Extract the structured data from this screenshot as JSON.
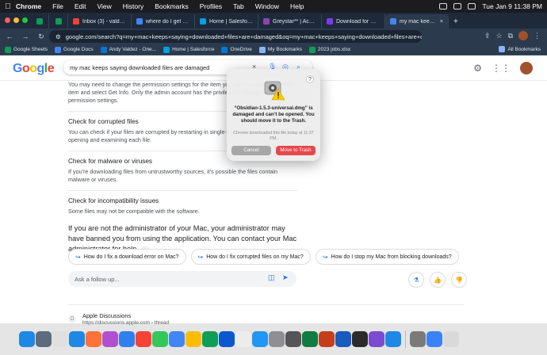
{
  "menubar": {
    "apple": "",
    "app": "Chrome",
    "items": [
      "File",
      "Edit",
      "View",
      "History",
      "Bookmarks",
      "Profiles",
      "Tab",
      "Window",
      "Help"
    ],
    "datetime": "Tue Jan 9  11:38 PM"
  },
  "tabs": [
    {
      "label": "",
      "color": "#0f9d58"
    },
    {
      "label": "",
      "color": "#0f9d58"
    },
    {
      "label": "Inbox (3) - valdez.andy",
      "color": "#ea4335"
    },
    {
      "label": "where do I get my inter",
      "color": "#4285f4"
    },
    {
      "label": "Home | Salesforce",
      "color": "#00a1e0"
    },
    {
      "label": "Greystar** | Account |",
      "color": "#8e44ad"
    },
    {
      "label": "Download for MacOS",
      "color": "#7c3aed"
    },
    {
      "label": "my mac keeps saying...",
      "color": "#4285f4",
      "active": true
    }
  ],
  "addressbar": {
    "url": "google.com/search?q=my+mac+keeps+saying+downloaded+files+are+damaged&oq=my+mac+keeps+saying+downloaded+files+are+da..."
  },
  "bookmarks": [
    {
      "label": "Google Sheets",
      "color": "#0f9d58"
    },
    {
      "label": "Google Docs",
      "color": "#4285f4"
    },
    {
      "label": "Andy Valdez - One...",
      "color": "#0078d4"
    },
    {
      "label": "Home | Salesforce",
      "color": "#00a1e0"
    },
    {
      "label": "OneDrive",
      "color": "#0078d4"
    },
    {
      "label": "My Bookmarks",
      "color": "#8ab4f8"
    },
    {
      "label": "2023 jobs.xlsx",
      "color": "#0f9d58"
    }
  ],
  "all_bookmarks": "All Bookmarks",
  "google": {
    "logo": "Google",
    "query": "my mac keeps saying downloaded files are damaged"
  },
  "answer": {
    "intro": "You may need to change the permission settings for the item you want to open. Select the item and select Get Info. Only the admin account has the privilege to change the permission settings.",
    "sections": [
      {
        "heading": "Check for corrupted files",
        "body": "You can check if your files are corrupted by restarting in single-user mode and manually opening and examining each file."
      },
      {
        "heading": "Check for malware or viruses",
        "body": "If you're downloading files from untrustworthy sources, it's possible the files contain malware or viruses."
      },
      {
        "heading": "Check for incompatibility issues",
        "body": "Some files may not be compatible with the software."
      }
    ],
    "admin_note": "If you are not the administrator of your Mac, your administrator may have banned you from using the application. You can contact your Mac administrator for help."
  },
  "chips": [
    "How do I fix a download error on Mac?",
    "How do I fix corrupted files on my Mac?",
    "How do I stop my Mac from blocking downloads?"
  ],
  "followup_placeholder": "Ask a follow up...",
  "result": {
    "name": "Apple Discussions",
    "url": "https://discussions.apple.com › thread"
  },
  "dialog": {
    "message": "“Obsidian-1.5.3-universal.dmg” is damaged and can’t be opened. You should move it to the Trash.",
    "subtext": "Chrome downloaded this file today at 11:37 PM.",
    "cancel": "Cancel",
    "confirm": "Move to Trash"
  },
  "colors": {
    "trash_button": "#e5484d",
    "link_blue": "#1a73e8"
  }
}
